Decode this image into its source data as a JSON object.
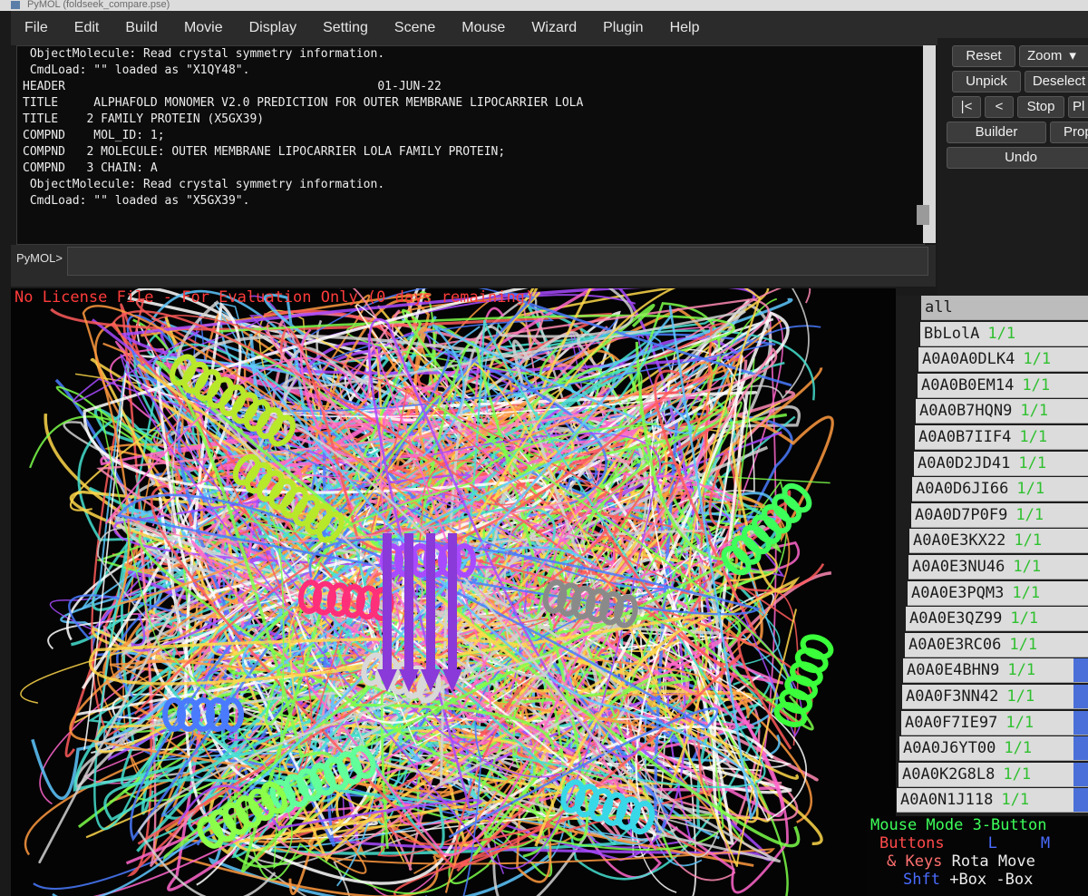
{
  "window": {
    "title": "PyMOL (foldseek_compare.pse)"
  },
  "menu": [
    "File",
    "Edit",
    "Build",
    "Movie",
    "Display",
    "Setting",
    "Scene",
    "Mouse",
    "Wizard",
    "Plugin",
    "Help"
  ],
  "console_lines": [
    " ObjectMolecule: Read crystal symmetry information.",
    " CmdLoad: \"\" loaded as \"X1QY48\".",
    "HEADER                                            01-JUN-22",
    "TITLE     ALPHAFOLD MONOMER V2.0 PREDICTION FOR OUTER MEMBRANE LIPOCARRIER LOLA",
    "TITLE    2 FAMILY PROTEIN (X5GX39)",
    "COMPND    MOL_ID: 1;",
    "COMPND   2 MOLECULE: OUTER MEMBRANE LIPOCARRIER LOLA FAMILY PROTEIN;",
    "COMPND   3 CHAIN: A",
    " ObjectMolecule: Read crystal symmetry information.",
    " CmdLoad: \"\" loaded as \"X5GX39\"."
  ],
  "command": {
    "prompt": "PyMOL>",
    "value": ""
  },
  "controls": {
    "reset": "Reset",
    "zoom": "Zoom",
    "unpick": "Unpick",
    "deselect": "Deselect",
    "rewind": "|<",
    "back": "<",
    "stop": "Stop",
    "play": "Pl",
    "builder": "Builder",
    "props": "Prop",
    "undo": "Undo"
  },
  "license_notice": "No License File - For Evaluation Only (0 days remaining)",
  "objects": [
    {
      "name": "all",
      "state": ""
    },
    {
      "name": "BbLolA",
      "state": "1/1"
    },
    {
      "name": "A0A0A0DLK4",
      "state": "1/1"
    },
    {
      "name": "A0A0B0EM14",
      "state": "1/1"
    },
    {
      "name": "A0A0B7HQN9",
      "state": "1/1"
    },
    {
      "name": "A0A0B7IIF4",
      "state": "1/1"
    },
    {
      "name": "A0A0D2JD41",
      "state": "1/1"
    },
    {
      "name": "A0A0D6JI66",
      "state": "1/1"
    },
    {
      "name": "A0A0D7P0F9",
      "state": "1/1"
    },
    {
      "name": "A0A0E3KX22",
      "state": "1/1"
    },
    {
      "name": "A0A0E3NU46",
      "state": "1/1"
    },
    {
      "name": "A0A0E3PQM3",
      "state": "1/1"
    },
    {
      "name": "A0A0E3QZ99",
      "state": "1/1"
    },
    {
      "name": "A0A0E3RC06",
      "state": "1/1"
    },
    {
      "name": "A0A0E4BHN9",
      "state": "1/1"
    },
    {
      "name": "A0A0F3NN42",
      "state": "1/1"
    },
    {
      "name": "A0A0F7IE97",
      "state": "1/1"
    },
    {
      "name": "A0A0J6YT00",
      "state": "1/1"
    },
    {
      "name": "A0A0K2G8L8",
      "state": "1/1"
    },
    {
      "name": "A0A0N1J118",
      "state": "1/1"
    }
  ],
  "mouse_panel": {
    "title": "Mouse Mode 3-Button",
    "buttons_label": "Buttons",
    "col_l": "L",
    "col_m": "M",
    "keys_label": "& Keys",
    "rota": "Rota",
    "move": "Move",
    "shft_label": "Shft",
    "box_add": "+Box",
    "box_sub": "-Box"
  },
  "colors": {
    "license_text": "#ff3b3b",
    "state_text": "#2fc02f",
    "mouse_title": "#3dff5a",
    "mouse_buttons": "#ff4a4a",
    "mouse_cols": "#4a6cff",
    "mouse_keys": "#ff6f6f",
    "mouse_shft": "#4a6cff",
    "ribbon_palette": [
      "#ffffff",
      "#5ec8ff",
      "#ff66cc",
      "#7cff4a",
      "#ffd84a",
      "#a84aff",
      "#ff5a5a",
      "#45e0d0",
      "#ff9a40",
      "#4a7bff",
      "#d2d2d2",
      "#ff8ab4"
    ]
  }
}
